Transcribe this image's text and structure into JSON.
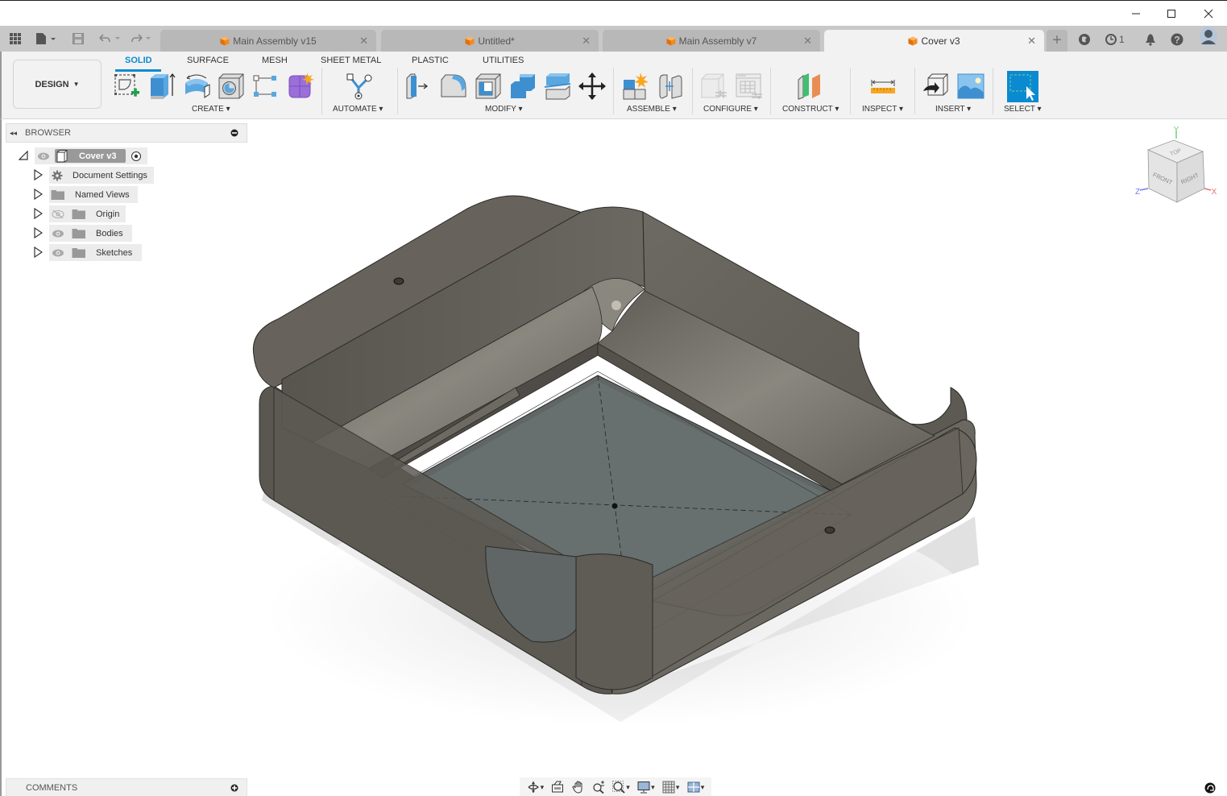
{
  "window": {
    "minimize_label": "—",
    "maximize_label": "☐",
    "close_label": "✕"
  },
  "quick_access": {
    "apps_icon": "grid-icon",
    "file_icon": "file-icon",
    "save_icon": "save-icon",
    "undo_icon": "undo-icon",
    "redo_icon": "redo-icon"
  },
  "tabs": [
    {
      "label": "Main Assembly v15",
      "active": false,
      "close": "✕"
    },
    {
      "label": "Untitled*",
      "active": false,
      "close": "✕"
    },
    {
      "label": "Main Assembly v7",
      "active": false,
      "close": "✕"
    },
    {
      "label": "Cover v3",
      "active": true,
      "close": "✕"
    }
  ],
  "tab_add_label": "+",
  "right_icons": {
    "job_status_count": "1"
  },
  "toolbar": {
    "workspace_label": "DESIGN",
    "workspace_tabs": [
      "SOLID",
      "SURFACE",
      "MESH",
      "SHEET METAL",
      "PLASTIC",
      "UTILITIES"
    ],
    "active_workspace_tab": "SOLID",
    "groups": {
      "create": "CREATE",
      "automate": "AUTOMATE",
      "modify": "MODIFY",
      "assemble": "ASSEMBLE",
      "configure": "CONFIGURE",
      "construct": "CONSTRUCT",
      "inspect": "INSPECT",
      "insert": "INSERT",
      "select": "SELECT"
    },
    "accent_color": "#0a8ad1"
  },
  "browser": {
    "title": "BROWSER",
    "root": {
      "label": "Cover v3"
    },
    "items": [
      {
        "label": "Document Settings",
        "icon": "gear-icon",
        "visibility": "none"
      },
      {
        "label": "Named Views",
        "icon": "folder-icon",
        "visibility": "none"
      },
      {
        "label": "Origin",
        "icon": "folder-icon",
        "visibility": "hidden"
      },
      {
        "label": "Bodies",
        "icon": "folder-icon",
        "visibility": "visible"
      },
      {
        "label": "Sketches",
        "icon": "folder-icon",
        "visibility": "visible"
      }
    ]
  },
  "viewcube": {
    "top": "TOP",
    "front": "FRONT",
    "right": "RIGHT",
    "axis_x": "X",
    "axis_y": "Y",
    "axis_z": "Z"
  },
  "comments": {
    "title": "COMMENTS"
  },
  "navbar": {
    "items": [
      "orbit-icon",
      "look-at-icon",
      "pan-icon",
      "zoom-icon",
      "fit-icon",
      "display-settings-icon",
      "grid-settings-icon",
      "viewports-icon"
    ]
  },
  "model": {
    "name": "Cover v3",
    "body_color": "#5e5b55"
  }
}
